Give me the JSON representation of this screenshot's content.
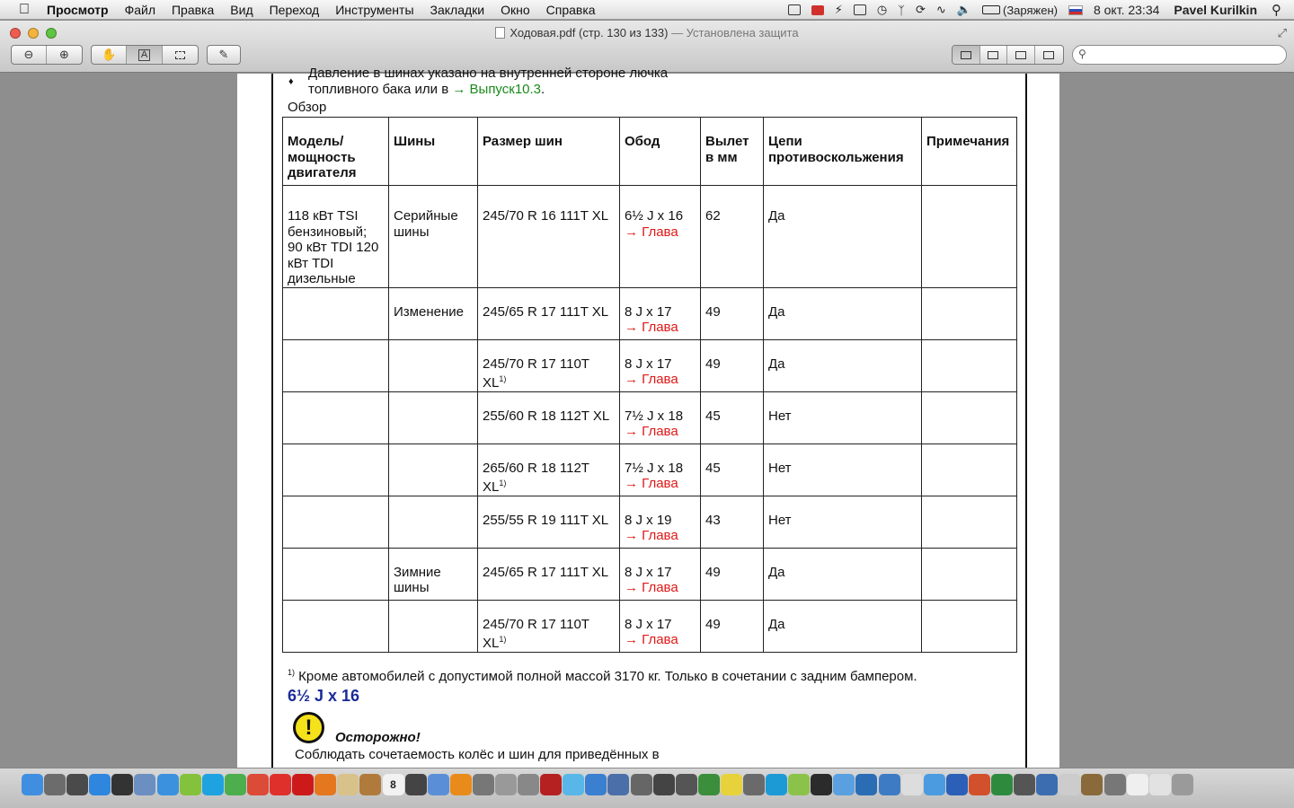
{
  "menubar": {
    "apple_icon": "apple-icon",
    "app_name": "Просмотр",
    "items": [
      "Файл",
      "Правка",
      "Вид",
      "Переход",
      "Инструменты",
      "Закладки",
      "Окно",
      "Справка"
    ],
    "battery_label": "(Заряжен)",
    "date": "8 окт.",
    "time": "23:34",
    "user": "Pavel Kurilkin"
  },
  "window": {
    "title": "Ходовая.pdf (стр. 130 из 133)",
    "subtitle": " — Установлена защита"
  },
  "toolbar": {
    "zoom_out_icon": "zoom-out-icon",
    "zoom_in_icon": "zoom-in-icon",
    "hand_icon": "hand-icon",
    "text_select_label": "A",
    "search_placeholder": ""
  },
  "document": {
    "bullet_line1": "Давление в шинах указано на внутренней стороне лючка",
    "bullet_line2_prefix": "топливного бака или в ",
    "bullet_link": "→ Выпуск10.3",
    "bullet_line2_suffix": ".",
    "overview_label": "Обзор",
    "table": {
      "headers": [
        "Модель/ мощность двигателя",
        "Шины",
        "Размер шин",
        "Обод",
        "Вылет в мм",
        "Цепи противоскольжения",
        "Примечания"
      ],
      "rows": [
        {
          "model": "118 кВт TSI бензиновый; 90 кВт TDI 120 кВт TDI дизельные",
          "tires": "Серийные шины",
          "size": "245/70 R 16 111T XL",
          "size_note": "",
          "rim": "6½ J x 16",
          "link": "→ Глава",
          "offset": "62",
          "chains": "Да",
          "notes": ""
        },
        {
          "model": "",
          "tires": "Изменение",
          "size": "245/65 R 17 111T XL",
          "size_note": "",
          "rim": "8 J x 17",
          "link": "→ Глава",
          "offset": "49",
          "chains": "Да",
          "notes": ""
        },
        {
          "model": "",
          "tires": "",
          "size": "245/70 R 17 110T XL",
          "size_note": "1)",
          "rim": "8 J x 17",
          "link": "→ Глава",
          "offset": "49",
          "chains": "Да",
          "notes": ""
        },
        {
          "model": "",
          "tires": "",
          "size": "255/60 R 18 112T XL",
          "size_note": "",
          "rim": "7½ J x 18",
          "link": "→ Глава",
          "offset": "45",
          "chains": "Нет",
          "notes": ""
        },
        {
          "model": "",
          "tires": "",
          "size": "265/60 R 18 112T XL",
          "size_note": "1)",
          "rim": "7½ J x 18",
          "link": "→ Глава",
          "offset": "45",
          "chains": "Нет",
          "notes": ""
        },
        {
          "model": "",
          "tires": "",
          "size": "255/55 R 19 111T XL",
          "size_note": "",
          "rim": "8 J x 19",
          "link": "→ Глава",
          "offset": "43",
          "chains": "Нет",
          "notes": ""
        },
        {
          "model": "",
          "tires": "Зимние шины",
          "size": "245/65 R 17 111T XL",
          "size_note": "",
          "rim": "8 J x 17",
          "link": "→ Глава",
          "offset": "49",
          "chains": "Да",
          "notes": ""
        },
        {
          "model": "",
          "tires": "",
          "size": "245/70 R 17 110T XL",
          "size_note": "1)",
          "rim": "8 J x 17",
          "link": "→ Глава",
          "offset": "49",
          "chains": "Да",
          "notes": ""
        }
      ]
    },
    "footnote_mark": "1)",
    "footnote": " Кроме автомобилей с допустимой полной массой 3170 кг. Только в сочетании с задним бампером.",
    "section_heading": "6½ J x 16",
    "warning_icon": "!",
    "warning_title": "Осторожно!",
    "warning_text": "Соблюдать сочетаемость колёс и шин для приведённых в"
  },
  "dock": {
    "icons": [
      {
        "name": "finder-icon",
        "color": "#3f8ee0"
      },
      {
        "name": "launchpad-icon",
        "color": "#6c6c6c"
      },
      {
        "name": "mission-control-icon",
        "color": "#4a4a4a"
      },
      {
        "name": "app-store-icon",
        "color": "#2f86df"
      },
      {
        "name": "dashboard-icon",
        "color": "#333333"
      },
      {
        "name": "preview-icon",
        "color": "#6b8fc0"
      },
      {
        "name": "safari-icon",
        "color": "#3b91dd"
      },
      {
        "name": "android-icon",
        "color": "#84c13d"
      },
      {
        "name": "skype-icon",
        "color": "#1ea2e0"
      },
      {
        "name": "facetime-icon",
        "color": "#4cae4c"
      },
      {
        "name": "chrome-icon",
        "color": "#dc4a38"
      },
      {
        "name": "yandex-icon",
        "color": "#e0302b"
      },
      {
        "name": "opera-icon",
        "color": "#cc1a1a"
      },
      {
        "name": "firefox-icon",
        "color": "#e5771e"
      },
      {
        "name": "notes-icon",
        "color": "#d9c289"
      },
      {
        "name": "photos-icon",
        "color": "#b07a3d"
      },
      {
        "name": "calendar-icon",
        "color": "#f2f2f2"
      },
      {
        "name": "photo-booth-icon",
        "color": "#444444"
      },
      {
        "name": "itunes-icon",
        "color": "#5a8fd8"
      },
      {
        "name": "vlc-icon",
        "color": "#e88b1a"
      },
      {
        "name": "launcher-icon",
        "color": "#777777"
      },
      {
        "name": "system-icon",
        "color": "#999999"
      },
      {
        "name": "calculator-icon",
        "color": "#888888"
      },
      {
        "name": "book-icon",
        "color": "#b52020"
      },
      {
        "name": "yandex-disk-icon",
        "color": "#58b7e8"
      },
      {
        "name": "sync-icon",
        "color": "#3a7fd0"
      },
      {
        "name": "quicktime-icon",
        "color": "#4b6fa8"
      },
      {
        "name": "lock-icon",
        "color": "#666666"
      },
      {
        "name": "video-icon",
        "color": "#444444"
      },
      {
        "name": "magic-icon",
        "color": "#555555"
      },
      {
        "name": "stocks-icon",
        "color": "#3b8e3b"
      },
      {
        "name": "stickies-icon",
        "color": "#e8d23c"
      },
      {
        "name": "tools-icon",
        "color": "#6a6a6a"
      },
      {
        "name": "skype-express-icon",
        "color": "#1b9ad6"
      },
      {
        "name": "monitor-icon",
        "color": "#8bc34a"
      },
      {
        "name": "activity-icon",
        "color": "#2b2b2b"
      },
      {
        "name": "network-icon",
        "color": "#5aa0e0"
      },
      {
        "name": "qt-player-icon",
        "color": "#2b6db5"
      },
      {
        "name": "files-icon",
        "color": "#3d7cc4"
      },
      {
        "name": "paper-icon",
        "color": "#dddddd"
      },
      {
        "name": "cloud-icon",
        "color": "#4b9be0"
      },
      {
        "name": "word-icon",
        "color": "#2b5fb8"
      },
      {
        "name": "powerpoint-icon",
        "color": "#d2502c"
      },
      {
        "name": "excel-icon",
        "color": "#2e8b3e"
      },
      {
        "name": "remote-icon",
        "color": "#555555"
      },
      {
        "name": "screen-icon",
        "color": "#3c6db0"
      },
      {
        "name": "script-icon",
        "color": "#cccccc"
      },
      {
        "name": "compass-icon",
        "color": "#8a6a3a"
      },
      {
        "name": "bluetooth-app-icon",
        "color": "#777777"
      },
      {
        "name": "doc-icon",
        "color": "#efefef"
      },
      {
        "name": "doc2-icon",
        "color": "#e2e2e2"
      },
      {
        "name": "trash-icon",
        "color": "#9a9a9a"
      }
    ],
    "calendar_day": "8"
  }
}
